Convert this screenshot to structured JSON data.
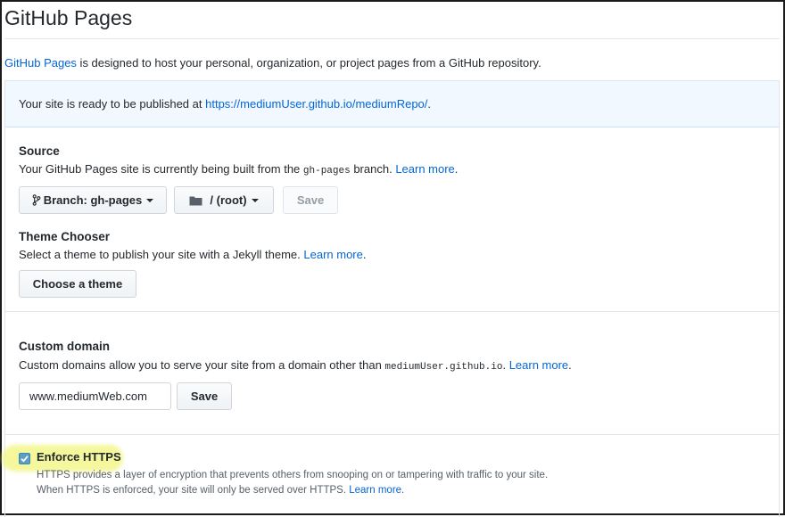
{
  "header": {
    "title": "GitHub Pages"
  },
  "intro": {
    "link_text": "GitHub Pages",
    "text": " is designed to host your personal, organization, or project pages from a GitHub repository."
  },
  "notice": {
    "prefix": "Your site is ready to be published at ",
    "url": "https://mediumUser.github.io/mediumRepo/",
    "suffix": "."
  },
  "source": {
    "title": "Source",
    "desc_prefix": "Your GitHub Pages site is currently being built from the ",
    "branch_code": "gh-pages",
    "desc_suffix": " branch. ",
    "learn_more": "Learn more",
    "learn_more_suffix": ".",
    "branch_button": "Branch: gh-pages",
    "folder_button": "/ (root)",
    "save_button": "Save"
  },
  "theme": {
    "title": "Theme Chooser",
    "desc": "Select a theme to publish your site with a Jekyll theme. ",
    "learn_more": "Learn more",
    "learn_more_suffix": ".",
    "choose_button": "Choose a theme"
  },
  "custom_domain": {
    "title": "Custom domain",
    "desc_prefix": "Custom domains allow you to serve your site from a domain other than ",
    "domain_code": "mediumUser.github.io",
    "desc_suffix": ". ",
    "learn_more": "Learn more",
    "learn_more_suffix": ".",
    "input_value": "www.mediumWeb.com",
    "save_button": "Save"
  },
  "https": {
    "label": "Enforce HTTPS",
    "checked": true,
    "note_line1": "HTTPS provides a layer of encryption that prevents others from snooping on or tampering with traffic to your site.",
    "note_line2_prefix": "When HTTPS is enforced, your site will only be served over HTTPS. ",
    "learn_more": "Learn more",
    "learn_more_suffix": "."
  },
  "colors": {
    "link": "#0366d6",
    "notice_bg": "#f1f8ff",
    "highlight": "#f1f57a"
  },
  "icons": {
    "branch": "git-branch-icon",
    "folder": "folder-icon",
    "check": "check-icon"
  }
}
